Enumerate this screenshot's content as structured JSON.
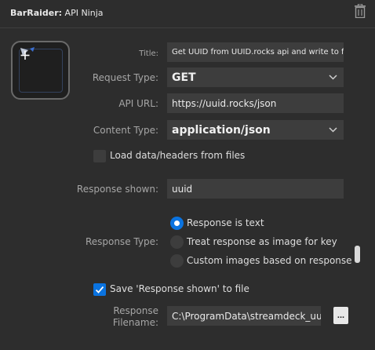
{
  "header": {
    "plugin_name": "BarRaider:",
    "action_name": " API Ninja"
  },
  "icons": {
    "trash": "trash-icon",
    "key": "plus-pointer-icon",
    "chevron": "chevron-down-icon",
    "check": "checkmark-icon"
  },
  "colors": {
    "background": "#2d2d2d",
    "field": "#3d3d3d",
    "accent": "#0a73e0"
  },
  "form": {
    "title": {
      "label": "Title:",
      "value": "Get UUID from UUID.rocks api and write to file"
    },
    "request_type": {
      "label": "Request Type:",
      "value": "GET"
    },
    "api_url": {
      "label": "API URL:",
      "value": "https://uuid.rocks/json"
    },
    "content_type": {
      "label": "Content Type:",
      "value": "application/json"
    },
    "load_from_files": {
      "label": "Load data/headers from files",
      "checked": false
    },
    "response_shown": {
      "label": "Response shown:",
      "value": "uuid"
    },
    "response_type": {
      "label": "Response Type:",
      "options": [
        {
          "label": "Response is text",
          "selected": true
        },
        {
          "label": "Treat response as image for key",
          "selected": false
        },
        {
          "label": "Custom images based on response",
          "selected": false
        }
      ]
    },
    "save_to_file": {
      "label": "Save 'Response shown' to file",
      "checked": true
    },
    "response_filename": {
      "label_line1": "Response",
      "label_line2": "Filename:",
      "value": "C:\\ProgramData\\streamdeck_uuid_",
      "browse_label": "..."
    }
  }
}
